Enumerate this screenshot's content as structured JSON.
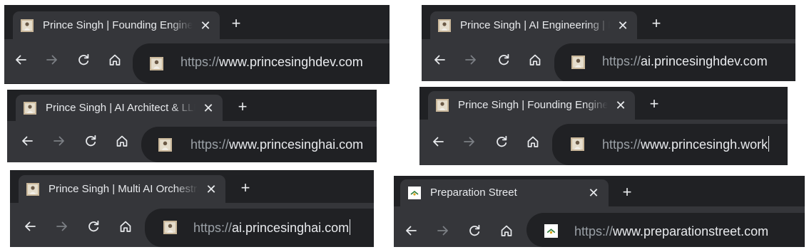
{
  "windows": [
    {
      "tab": {
        "title": "Prince Singh | Founding Engineer",
        "favicon": "person-photo-icon",
        "close_label": "✕"
      },
      "new_tab_label": "+",
      "address": {
        "scheme": "https://",
        "host": "www.princesinghdev.com",
        "favicon": "person-photo-icon",
        "cursor": false
      }
    },
    {
      "tab": {
        "title": "Prince Singh | AI Engineering | M",
        "favicon": "person-photo-icon",
        "close_label": "✕"
      },
      "new_tab_label": "+",
      "address": {
        "scheme": "https://",
        "host": "ai.princesinghdev.com",
        "favicon": "person-photo-icon",
        "cursor": false
      }
    },
    {
      "tab": {
        "title": "Prince Singh | AI Architect & LLM",
        "favicon": "person-photo-icon",
        "close_label": "✕"
      },
      "new_tab_label": "+",
      "address": {
        "scheme": "https://",
        "host": "www.princesinghai.com",
        "favicon": "person-photo-icon",
        "cursor": false
      }
    },
    {
      "tab": {
        "title": "Prince Singh | Founding Engineer",
        "favicon": "person-photo-icon",
        "close_label": "✕"
      },
      "new_tab_label": "+",
      "address": {
        "scheme": "https://",
        "host": "www.princesingh.work",
        "favicon": "person-photo-icon",
        "cursor": true
      }
    },
    {
      "tab": {
        "title": "Prince Singh | Multi AI Orchestra",
        "favicon": "person-photo-icon",
        "close_label": "✕"
      },
      "new_tab_label": "+",
      "address": {
        "scheme": "https://",
        "host": "ai.princesinghai.com",
        "favicon": "person-photo-icon",
        "cursor": true
      }
    },
    {
      "tab": {
        "title": "Preparation Street",
        "favicon": "preparation-street-logo-icon",
        "close_label": "✕"
      },
      "new_tab_label": "+",
      "address": {
        "scheme": "https://",
        "host": "www.preparationstreet.com",
        "favicon": "preparation-street-logo-icon",
        "cursor": false
      }
    }
  ],
  "colors": {
    "tabstrip_bg": "#202124",
    "tab_active_bg": "#35363a",
    "omnibox_bg": "#202124",
    "text_primary": "#e8eaed",
    "text_dim": "#9aa0a6",
    "forward_disabled": "#7b7f84"
  }
}
